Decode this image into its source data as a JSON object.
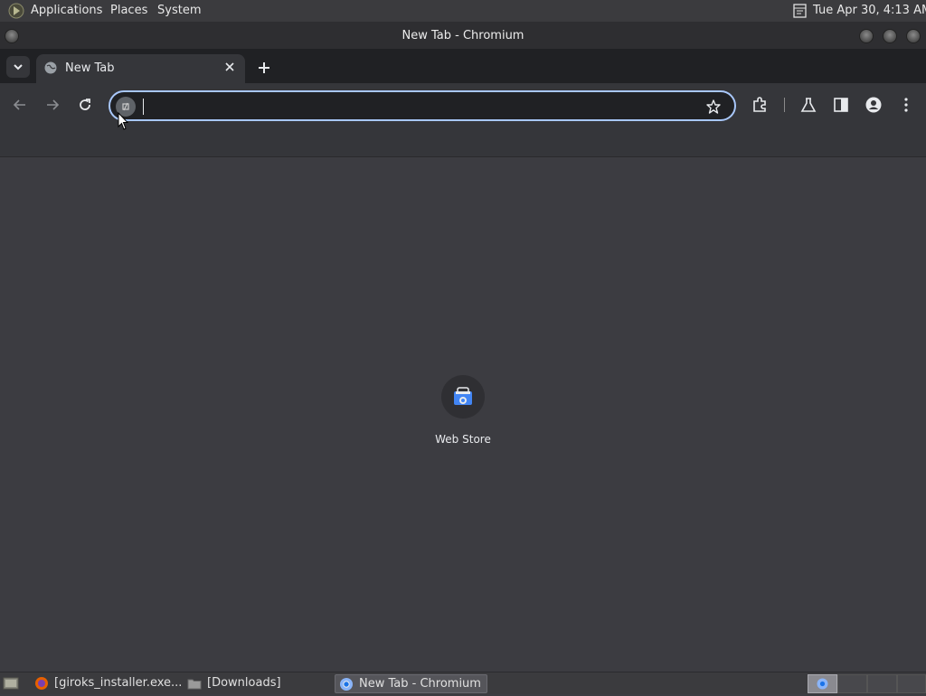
{
  "top_panel": {
    "menus": [
      "Applications",
      "Places",
      "System"
    ],
    "clock": "Tue Apr 30,  4:13 AM",
    "logo_icon": "gnome-foot-icon",
    "clock_icon": "calendar-clock-icon"
  },
  "window": {
    "title": "New Tab - Chromium"
  },
  "browser": {
    "tabs": [
      {
        "label": "New Tab",
        "icon": "globe-icon",
        "active": true
      }
    ],
    "omnibox": {
      "value": "",
      "placeholder": ""
    },
    "toolbar_icons": [
      "back-icon",
      "forward-icon",
      "reload-icon",
      "star-icon",
      "extensions-icon",
      "labs-flask-icon",
      "side-panel-icon",
      "profile-icon",
      "more-menu-icon"
    ]
  },
  "page": {
    "shortcuts": [
      {
        "label": "Web Store",
        "icon": "web-store-icon"
      }
    ]
  },
  "taskbar": {
    "tasks": [
      {
        "label": "[giroks_installer.exe...",
        "icon": "firefox-icon"
      },
      {
        "label": "[Downloads]",
        "icon": "folder-icon"
      },
      {
        "label": "New Tab - Chromium",
        "icon": "chromium-icon",
        "active": true
      }
    ],
    "workspaces": 4
  },
  "colors": {
    "accent": "#a8c7fa",
    "tab_strip": "#202124",
    "toolbar": "#35363a",
    "page_bg": "#3c3c41"
  }
}
